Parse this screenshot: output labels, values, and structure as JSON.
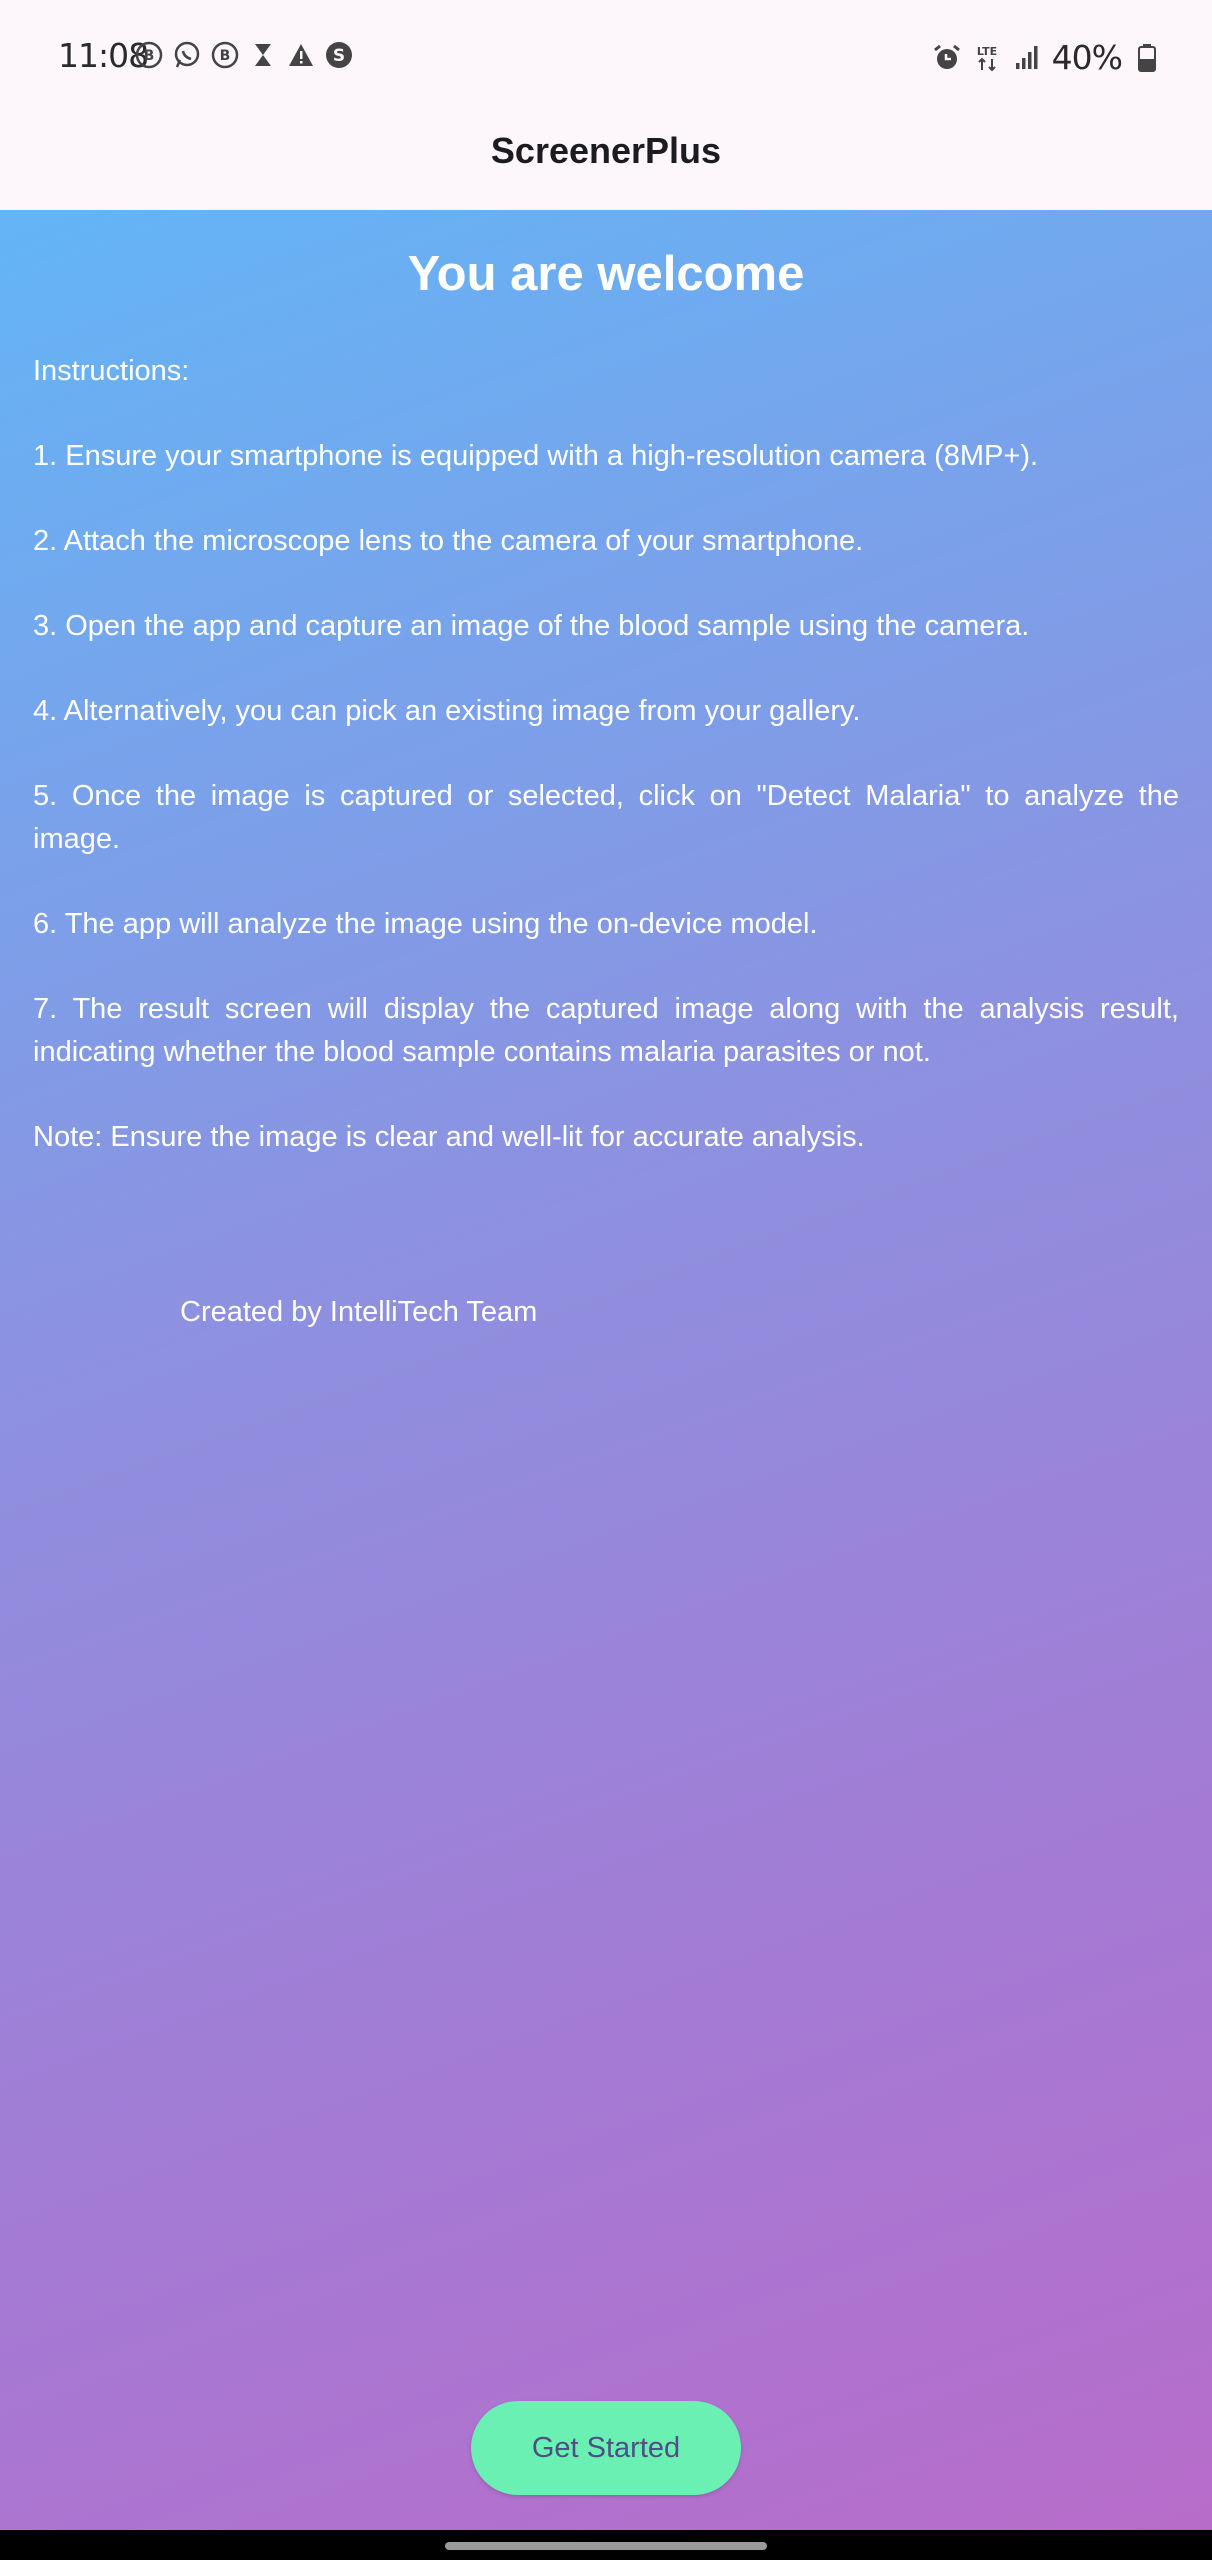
{
  "status_bar": {
    "time": "11:08",
    "left_icons": [
      "b-badge-icon",
      "whatsapp-icon",
      "b-badge-icon",
      "hourglass-icon",
      "warning-icon",
      "s-badge-icon"
    ],
    "right_icons": [
      "alarm-icon",
      "lte-icon",
      "signal-icon",
      "battery-icon"
    ],
    "battery": "40%",
    "network": "LTE"
  },
  "app_bar": {
    "title": "ScreenerPlus"
  },
  "main": {
    "heading": "You are welcome",
    "instructions": [
      "Instructions:",
      "1. Ensure your smartphone is equipped with a high-resolution camera (8MP+).",
      "2. Attach the microscope lens to the camera of your smartphone.",
      "3. Open the app and capture an image of the blood sample using the camera.",
      "4. Alternatively, you can pick an existing image from your gallery.",
      "5. Once the image is captured or selected, click on \"Detect Malaria\" to analyze the image.",
      "6. The app will analyze the image using the on-device model.",
      "7. The result screen will display the captured image along with the analysis result, indicating whether the blood sample contains malaria parasites or not.",
      "Note: Ensure the image is clear and well-lit for accurate analysis."
    ],
    "credits": "Created by IntelliTech Team",
    "button_label": "Get Started"
  },
  "colors": {
    "gradient_start": "#63b5f6",
    "gradient_end": "#b86cca",
    "button_bg": "#69f0b2",
    "button_text": "#4f4e86"
  }
}
